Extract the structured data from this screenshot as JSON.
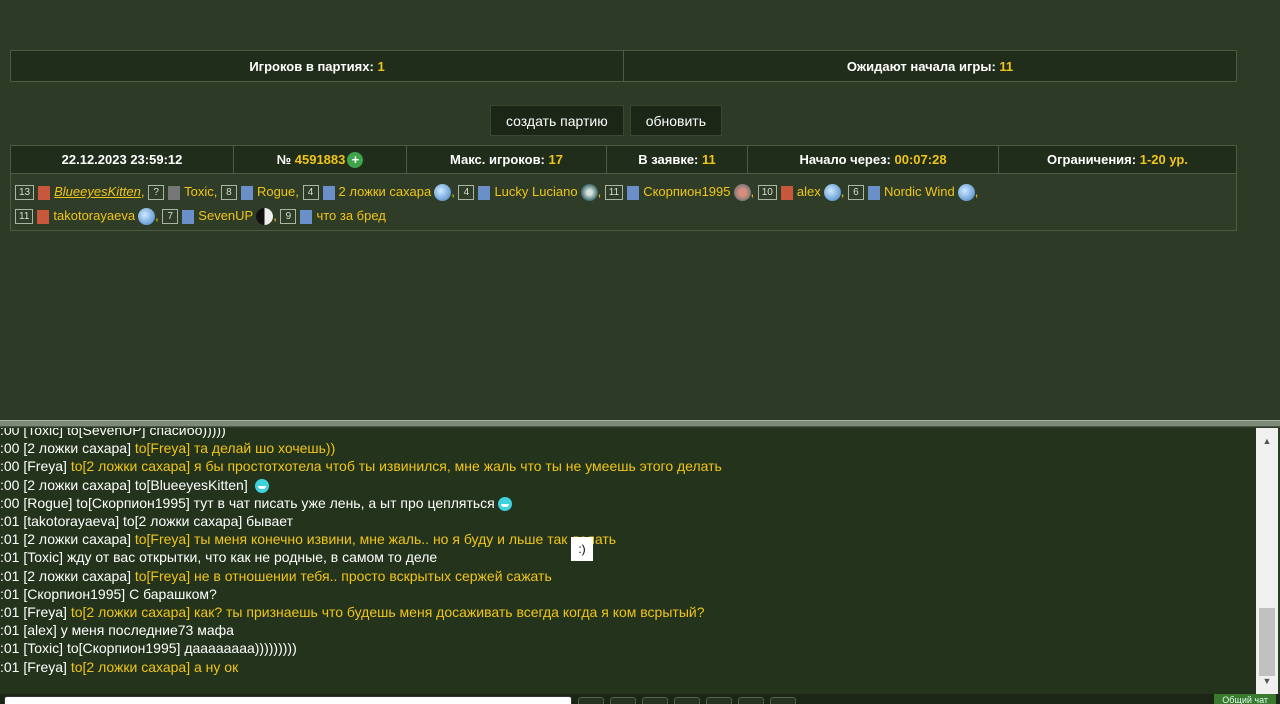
{
  "stats": {
    "in_games_label": "Игроков в партиях:",
    "in_games_value": "1",
    "waiting_label": "Ожидают начала игры:",
    "waiting_value": "11"
  },
  "buttons": {
    "create": "создать партию",
    "refresh": "обновить"
  },
  "game": {
    "datetime": "22.12.2023 23:59:12",
    "number_label": "№",
    "number_value": "4591883",
    "max_players_label": "Макс. игроков:",
    "max_players_value": "17",
    "in_request_label": "В заявке:",
    "in_request_value": "11",
    "start_label": "Начало через:",
    "start_value": "00:07:28",
    "restrict_label": "Ограничения:",
    "restrict_value": "1-20 ур."
  },
  "players": [
    {
      "level": "13",
      "name": "BlueeyesKitten",
      "icon": "red"
    },
    {
      "level": "?",
      "name": "Toxic",
      "icon": "grey"
    },
    {
      "level": "8",
      "name": "Rogue",
      "icon": "blue"
    },
    {
      "level": "4",
      "name": "2 ложки сахара",
      "icon": "blue",
      "badge": "globe"
    },
    {
      "level": "4",
      "name": "Lucky Luciano",
      "icon": "blue",
      "badge": "star"
    },
    {
      "level": "11",
      "name": "Скорпион1995",
      "icon": "blue",
      "badge": "cross"
    },
    {
      "level": "10",
      "name": "alex",
      "icon": "red",
      "badge": "globe"
    },
    {
      "level": "6",
      "name": "Nordic Wind",
      "icon": "blue",
      "badge": "globe"
    },
    {
      "level": "11",
      "name": "takotorayaeva",
      "icon": "red",
      "badge": "globe"
    },
    {
      "level": "7",
      "name": "SevenUP",
      "icon": "blue",
      "badge": "yin"
    },
    {
      "level": "9",
      "name": "что за бред",
      "icon": "blue"
    }
  ],
  "chat": [
    {
      "time": ":00",
      "from": "[Toxic]",
      "to": "to[SevenUP]",
      "msg": "спасибо)))))",
      "hl": false
    },
    {
      "time": ":00",
      "from": "[2 ложки сахара]",
      "to": "to[Freya]",
      "msg": "та делай шо хочешь))",
      "hl": true
    },
    {
      "time": ":00",
      "from": "[Freya]",
      "to": "to[2 ложки сахара]",
      "msg": "я бы простотхотела чтоб ты извинился, мне жаль что ты не умеешь этого делать",
      "hl": true
    },
    {
      "time": ":00",
      "from": "[2 ложки сахара]",
      "to": "to[BlueeyesKitten]",
      "msg": "",
      "hl": false,
      "smile": true
    },
    {
      "time": ":00",
      "from": "[Rogue]",
      "to": "to[Скорпион1995]",
      "msg": "тут в чат писать уже лень, а ыт про цепляться",
      "hl": false,
      "smile": true
    },
    {
      "time": ":01",
      "from": "[takotorayaeva]",
      "to": "to[2 ложки сахара]",
      "msg": "бывает",
      "hl": false
    },
    {
      "time": ":01",
      "from": "[2 ложки сахара]",
      "to": "to[Freya]",
      "msg": "ты меня конечно извини, мне жаль.. но я буду и    льше так делать",
      "hl": true
    },
    {
      "time": ":01",
      "from": "[Toxic]",
      "to": "",
      "msg": "жду от вас открытки, что как не родные, в самом то деле",
      "hl": false
    },
    {
      "time": ":01",
      "from": "[2 ложки сахара]",
      "to": "to[Freya]",
      "msg": "не в отношении тебя.. просто вскрытых сержей сажать",
      "hl": true
    },
    {
      "time": ":01",
      "from": "[Скорпион1995]",
      "to": "",
      "msg": "С барашком?",
      "hl": false
    },
    {
      "time": ":01",
      "from": "[Freya]",
      "to": "to[2 ложки сахара]",
      "msg": "как? ты признаешь что будешь меня досаживать всегда когда я ком всрытый?",
      "hl": true
    },
    {
      "time": ":01",
      "from": "[alex]",
      "to": "",
      "msg": "у меня последние73 мафа",
      "hl": false
    },
    {
      "time": ":01",
      "from": "[Toxic]",
      "to": "to[Скорпион1995]",
      "msg": "даааааааа)))))))))",
      "hl": false
    },
    {
      "time": ":01",
      "from": "[Freya]",
      "to": "to[2 ложки сахара]",
      "msg": "а ну ок",
      "hl": true
    }
  ],
  "tooltip": ":)",
  "chat_tab": "Общий чат",
  "colors": {
    "accent": "#f0c419",
    "background": "#2d3b26",
    "chat_bg": "#24341c"
  }
}
